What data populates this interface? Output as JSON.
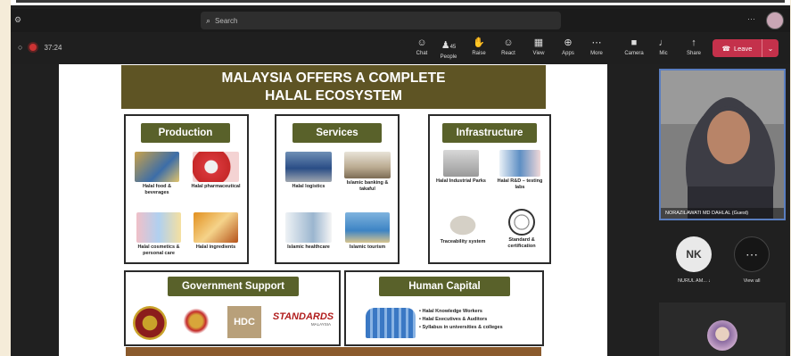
{
  "titlebar": {
    "search_placeholder": "Search",
    "more": "···"
  },
  "toolbar": {
    "timer": "37:24",
    "items": [
      {
        "label": "Chat",
        "icon": "chat-icon",
        "glyph": "☺"
      },
      {
        "label": "People",
        "icon": "people-icon",
        "glyph": "♟",
        "badge": "45"
      },
      {
        "label": "Raise",
        "icon": "raise-hand-icon",
        "glyph": "✋"
      },
      {
        "label": "React",
        "icon": "react-icon",
        "glyph": "☺"
      },
      {
        "label": "View",
        "icon": "view-icon",
        "glyph": "▦"
      },
      {
        "label": "Apps",
        "icon": "apps-icon",
        "glyph": "⊕"
      },
      {
        "label": "More",
        "icon": "more-icon",
        "glyph": "⋯"
      },
      {
        "label": "Camera",
        "icon": "camera-icon",
        "glyph": "■"
      },
      {
        "label": "Mic",
        "icon": "mic-icon",
        "glyph": "♩"
      },
      {
        "label": "Share",
        "icon": "share-icon",
        "glyph": "↑"
      }
    ],
    "leave_label": "Leave"
  },
  "slide": {
    "title_line1": "MALAYSIA OFFERS A COMPLETE",
    "title_line2": "HALAL ECOSYSTEM",
    "production": {
      "header": "Production",
      "tiles": [
        "Halal food & beverages",
        "Halal pharmaceutical",
        "Halal cosmetics & personal care",
        "Halal ingredients"
      ]
    },
    "services": {
      "header": "Services",
      "tiles": [
        "Halal logistics",
        "Islamic banking & takaful",
        "Islamic healthcare",
        "Islamic tourism"
      ]
    },
    "infrastructure": {
      "header": "Infrastructure",
      "tiles": [
        "Halal Industrial Parks",
        "Halal R&D – testing labs",
        "Traceability system",
        "Standard & certification"
      ]
    },
    "government": {
      "header": "Government Support",
      "logo_hdc": "HDC",
      "logo_standards": "STANDARDS",
      "logo_standards_sub": "MALAYSIA"
    },
    "human_capital": {
      "header": "Human Capital",
      "bullets": [
        "Halal Knowledge Workers",
        "Halal Executives & Auditors",
        "Syllabus in universities & colleges"
      ]
    }
  },
  "participants": {
    "presenter_name": "NORAZILAWATI MD DAHLAL (Guest)",
    "nk_initials": "NK",
    "nk_name": "NURUL AM...",
    "view_all_icon": "⋯",
    "view_all_label": "View all"
  },
  "colors": {
    "accent_olive": "#59612a",
    "leave_red": "#c4314b",
    "banner": "#5e5424"
  }
}
